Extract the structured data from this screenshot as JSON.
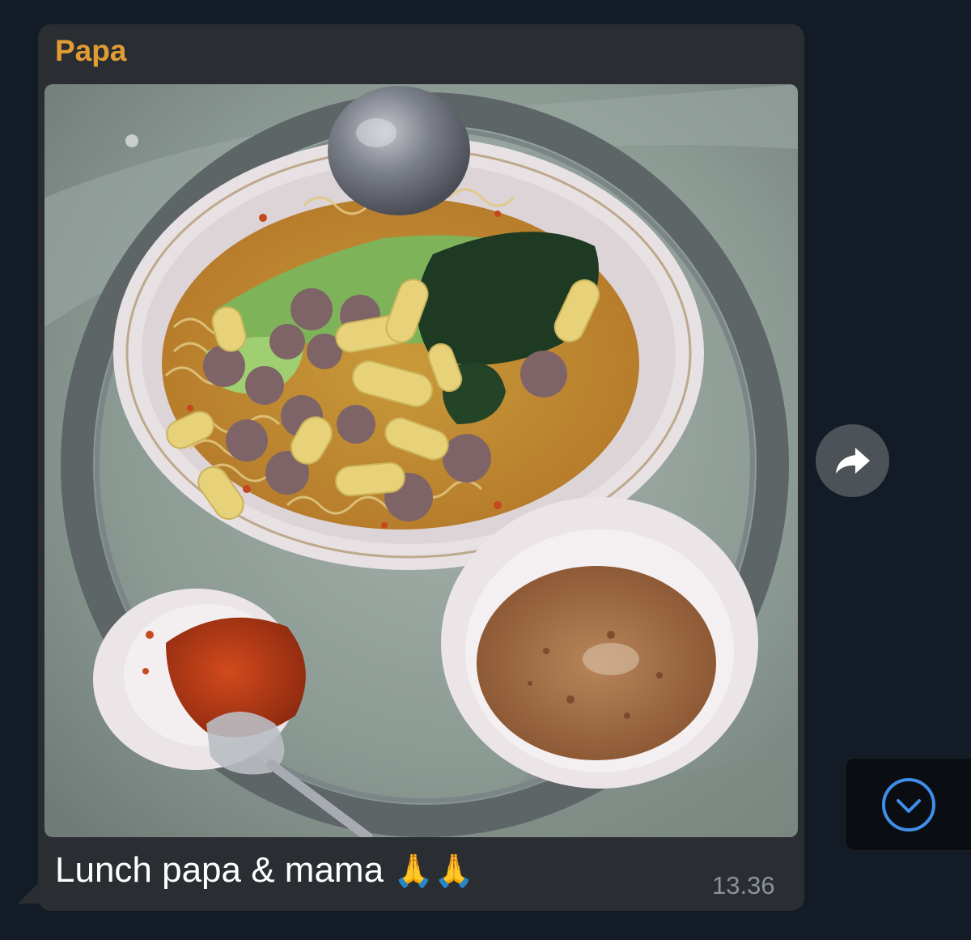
{
  "message": {
    "sender": "Papa",
    "caption": "Lunch papa & mama",
    "caption_emoji": "🙏🙏",
    "time": "13.36",
    "photo": {
      "description_icon": "food-photo-noodle-soup"
    }
  },
  "controls": {
    "forward_icon": "forward-arrow-icon",
    "scroll_down_icon": "chevron-down-circle-icon"
  },
  "colors": {
    "background": "#131c26",
    "bubble": "#2a2e33",
    "sender": "#e29c34",
    "time": "#8b9299",
    "accent": "#3e8fe8"
  }
}
